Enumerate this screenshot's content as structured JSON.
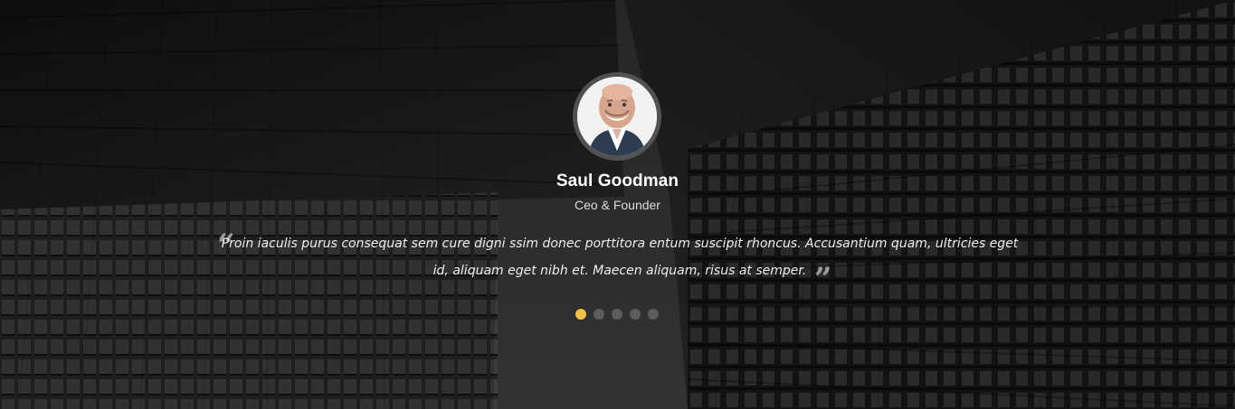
{
  "testimonial": {
    "name": "Saul Goodman",
    "role": "Ceo & Founder",
    "quote": "Proin iaculis purus consequat sem cure digni ssim donec porttitora entum suscipit rhoncus. Accusantium quam, ultricies eget id, aliquam eget nibh et. Maecen aliquam, risus at semper.",
    "quote_open": "“",
    "quote_close": "”"
  },
  "slider": {
    "slides": 5,
    "active_index": 0
  },
  "colors": {
    "active_dot": "#f0c04a",
    "inactive_dot": "#5d5d5d",
    "text": "#ffffff"
  },
  "icons": {
    "avatar": "person-portrait",
    "open_quote": "open-quote-icon",
    "close_quote": "close-quote-icon"
  }
}
